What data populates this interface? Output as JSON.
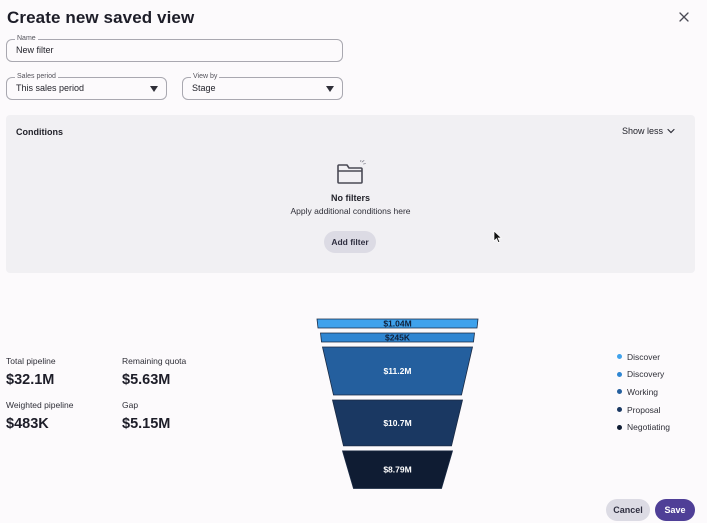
{
  "dialog": {
    "title": "Create new saved view",
    "close_icon": "close-icon"
  },
  "form": {
    "name": {
      "label": "Name",
      "value": "New filter"
    },
    "sales_period": {
      "label": "Sales period",
      "value": "This sales period"
    },
    "view_by": {
      "label": "View by",
      "value": "Stage"
    }
  },
  "conditions": {
    "title": "Conditions",
    "toggle_label": "Show less",
    "empty_title": "No filters",
    "empty_subtitle": "Apply additional conditions here",
    "add_filter_label": "Add filter",
    "empty_icon": "folder-icon"
  },
  "metrics": {
    "total_pipeline": {
      "label": "Total pipeline",
      "value": "$32.1M"
    },
    "remaining_quota": {
      "label": "Remaining quota",
      "value": "$5.63M"
    },
    "weighted_pipeline": {
      "label": "Weighted pipeline",
      "value": "$483K"
    },
    "gap": {
      "label": "Gap",
      "value": "$5.15M"
    }
  },
  "chart_data": {
    "type": "funnel",
    "stages": [
      {
        "name": "Discover",
        "value": 1.04,
        "label": "$1.04M",
        "color": "#3fa2ec"
      },
      {
        "name": "Discovery",
        "value": 0.245,
        "label": "$245K",
        "color": "#2f86d2"
      },
      {
        "name": "Working",
        "value": 11.2,
        "label": "$11.2M",
        "color": "#245f9e"
      },
      {
        "name": "Proposal",
        "value": 10.7,
        "label": "$10.7M",
        "color": "#1a3862"
      },
      {
        "name": "Negotiating",
        "value": 8.79,
        "label": "$8.79M",
        "color": "#0f1c33"
      }
    ],
    "legend_position": "right"
  },
  "footer": {
    "cancel_label": "Cancel",
    "save_label": "Save"
  },
  "colors": {
    "primary": "#4f3f97",
    "secondary_button": "#dcdbe4",
    "panel": "#f1f0f3"
  }
}
